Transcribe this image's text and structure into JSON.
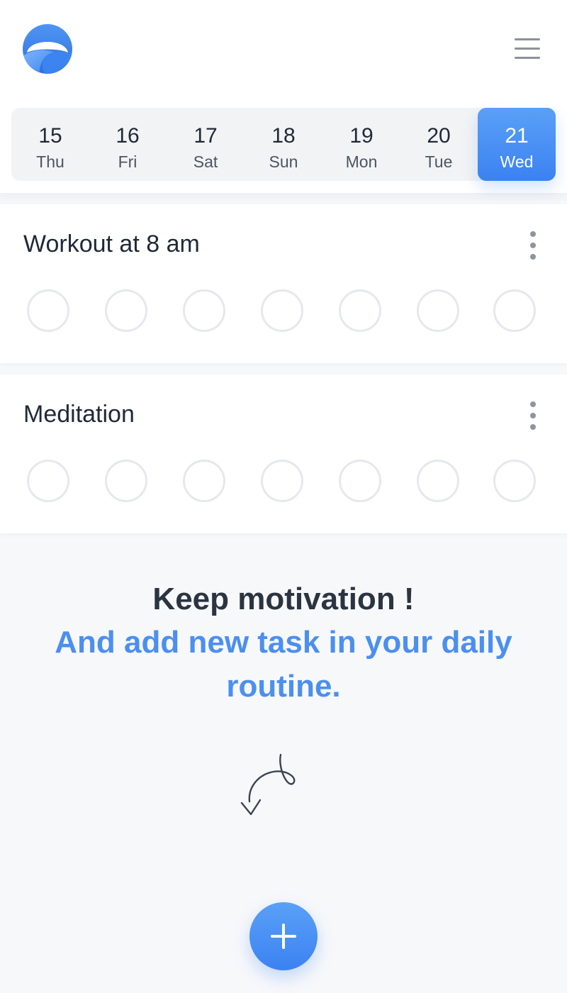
{
  "header": {
    "logo_icon": "sun-horizon-logo-icon",
    "menu_icon": "hamburger-menu-icon"
  },
  "date_strip": {
    "days": [
      {
        "num": "15",
        "weekday": "Thu"
      },
      {
        "num": "16",
        "weekday": "Fri"
      },
      {
        "num": "17",
        "weekday": "Sat"
      },
      {
        "num": "18",
        "weekday": "Sun"
      },
      {
        "num": "19",
        "weekday": "Mon"
      },
      {
        "num": "20",
        "weekday": "Tue"
      },
      {
        "num": "21",
        "weekday": "Wed"
      }
    ],
    "selected": "21"
  },
  "tasks": [
    {
      "title": "Workout at 8 am",
      "menu_icon": "more-vertical-icon"
    },
    {
      "title": "Meditation",
      "menu_icon": "more-vertical-icon"
    }
  ],
  "motivation": {
    "line1": "Keep motivation !",
    "line2": "And add new task in your daily routine."
  },
  "arrow_icon": "curly-arrow-down-icon",
  "add_button": {
    "icon": "plus-icon"
  },
  "colors": {
    "accent": "#3b82f2",
    "accent_light": "#5aa0f7",
    "title_text": "#1f2937",
    "motivation_dark": "#2b3441",
    "motivation_blue": "#4b8ff0",
    "circle_border": "#e6e8ee",
    "background": "#f7f8fa"
  }
}
